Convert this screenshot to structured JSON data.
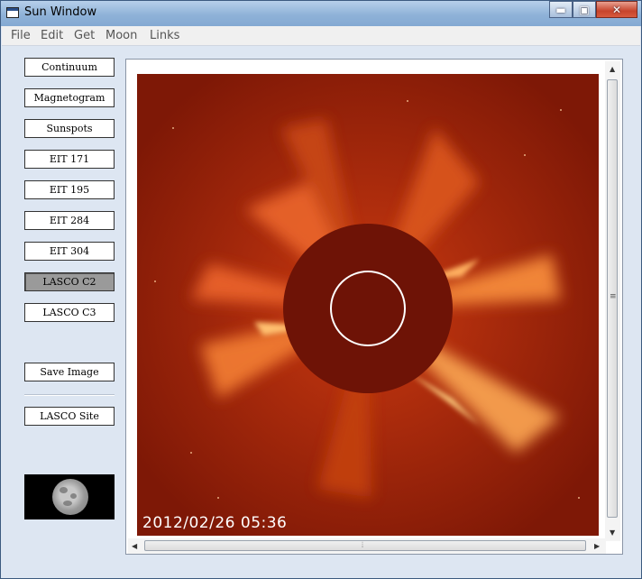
{
  "window": {
    "title": "Sun Window",
    "close_glyph": "✕",
    "min_glyph": "▬",
    "max_glyph": "▣"
  },
  "menu": [
    "File",
    "Edit",
    "Get",
    "Moon",
    "Links"
  ],
  "buttons": {
    "continuum": "Continuum",
    "magnetogram": "Magnetogram",
    "sunspots": "Sunspots",
    "eit171": "EIT 171",
    "eit195": "EIT 195",
    "eit284": "EIT 284",
    "eit304": "EIT 304",
    "lasco_c2": "LASCO C2",
    "lasco_c3": "LASCO C3",
    "save_image": "Save Image",
    "lasco_site": "LASCO Site"
  },
  "selected_button": "LASCO C2",
  "image": {
    "timestamp": "2012/02/26  05:36"
  },
  "colors": {
    "corona_base": "#8b1c08",
    "occulter": "#6e1306",
    "sun_circle": "#ffffff"
  },
  "icons": {
    "window": "window-icon",
    "moon": "moon-phase-thumbnail"
  }
}
